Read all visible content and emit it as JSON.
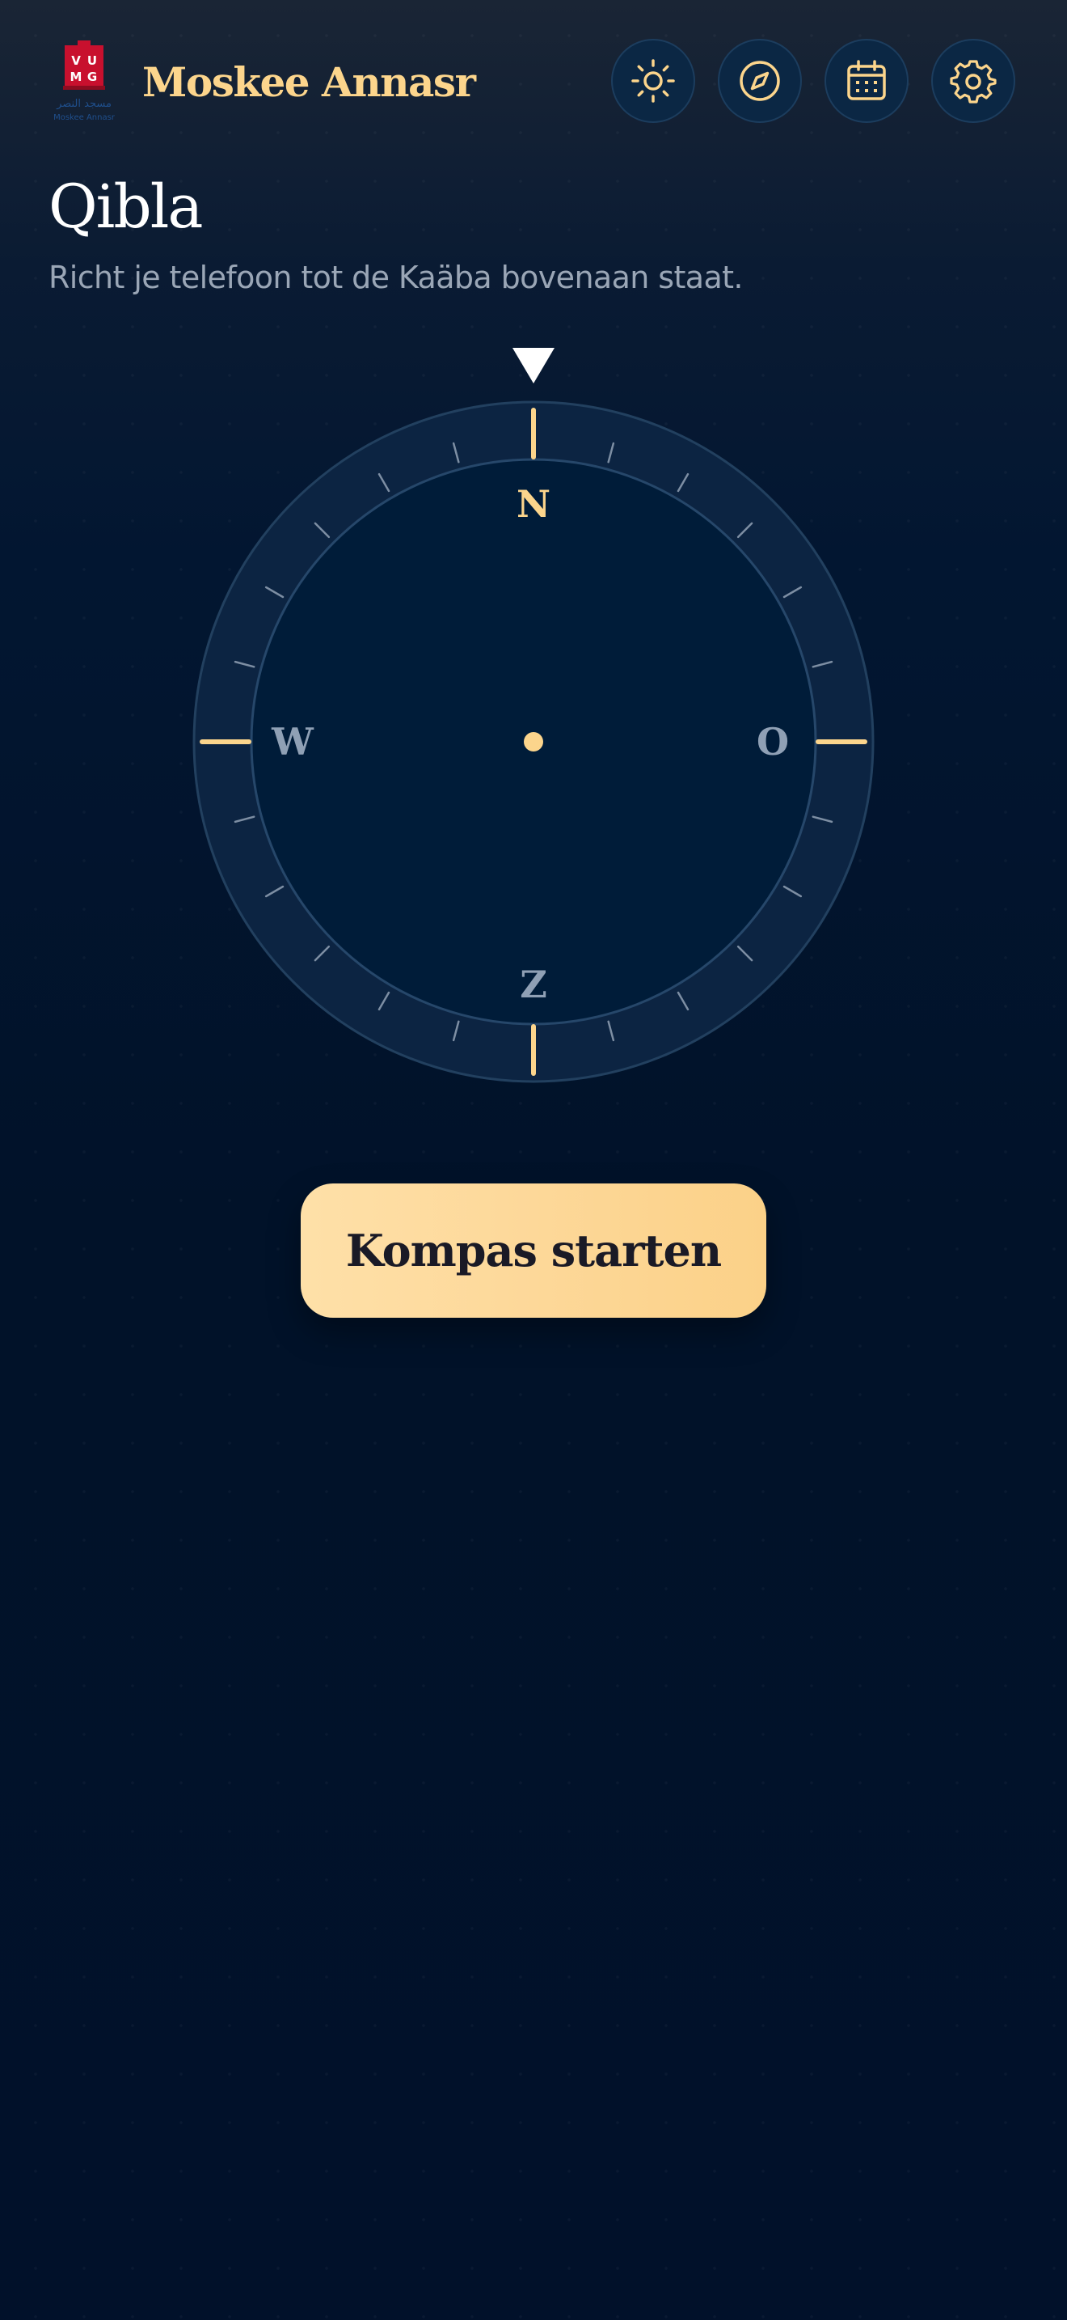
{
  "header": {
    "logo": {
      "letters": "VUMG",
      "arabic": "مسجد النصر",
      "latin": "Moskee Annasr"
    },
    "title": "Moskee Annasr",
    "buttons": [
      {
        "icon": "sun-icon",
        "label": "Gebedstijden"
      },
      {
        "icon": "compass-icon",
        "label": "Qibla"
      },
      {
        "icon": "calendar-icon",
        "label": "Kalender"
      },
      {
        "icon": "gear-icon",
        "label": "Instellingen"
      }
    ]
  },
  "main": {
    "title": "Qibla",
    "subtitle": "Richt je telefoon tot de Kaäba bovenaan staat."
  },
  "compass": {
    "north": "N",
    "east": "O",
    "south": "Z",
    "west": "W",
    "tick_count": 24
  },
  "actions": {
    "start_label": "Kompas starten"
  },
  "colors": {
    "accent": "#fcd58c",
    "background": "#01132a",
    "muted_text": "#9aa6b6",
    "logo_red": "#c8102e"
  }
}
